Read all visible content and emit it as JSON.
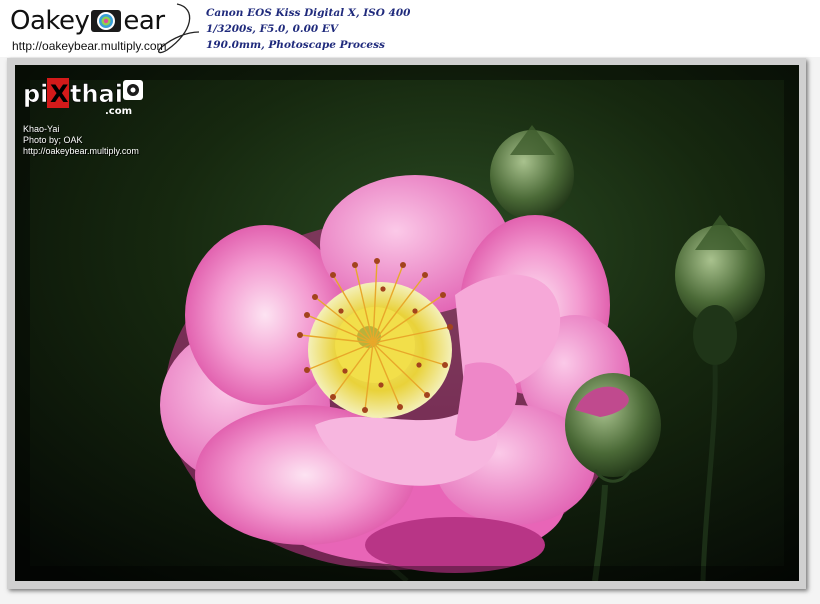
{
  "header": {
    "brand_left": "Oakey",
    "brand_box": "O",
    "brand_right": "ear",
    "url": "http://oakeybear.multiply.com"
  },
  "exif": {
    "line1": "Canon EOS Kiss Digital X, ISO 400",
    "line2": "1/3200s, F5.0, 0.00 EV",
    "line3": "190.0mm, Photoscape Process"
  },
  "watermark": {
    "logo_text": "piXthai",
    "logo_suffix": ".com",
    "location": "Khao-Yai",
    "credit": "Photo by; OAK",
    "url": "http://oakeybear.multiply.com"
  },
  "colors": {
    "exif_text": "#1f2a7c",
    "petal": "#f07ec6",
    "stamen": "#f0c814",
    "background": "#0b1309"
  }
}
